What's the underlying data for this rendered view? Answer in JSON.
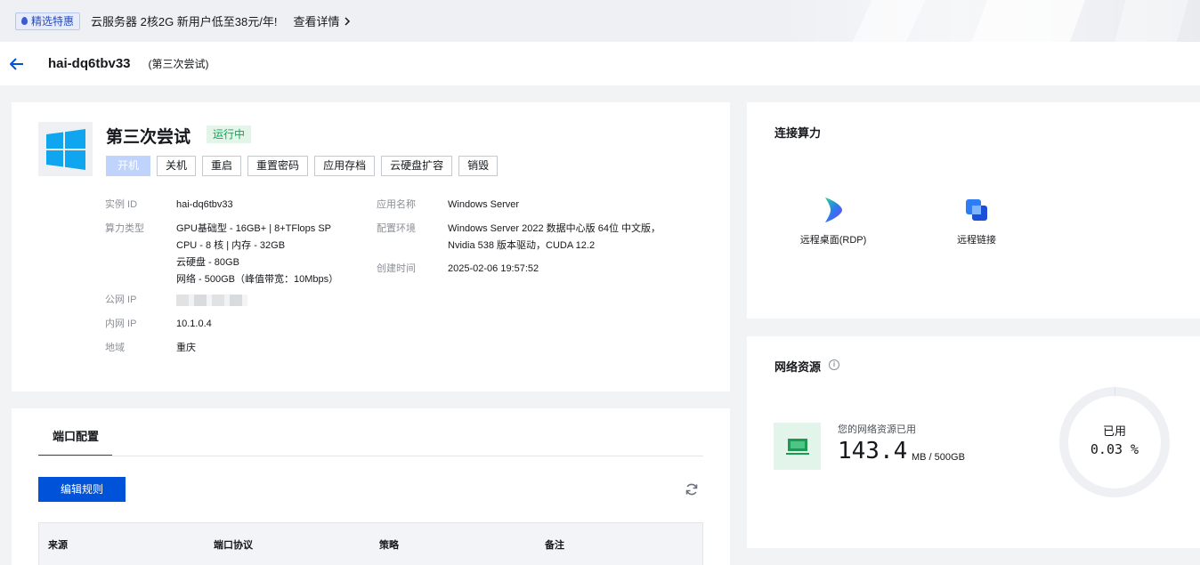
{
  "promo": {
    "badge": "精选特惠",
    "text": "云服务器 2核2G 新用户低至38元/年!",
    "link": "查看详情"
  },
  "header": {
    "title": "hai-dq6tbv33",
    "subtitle": "(第三次尝试)"
  },
  "instance": {
    "name": "第三次尝试",
    "status": "运行中",
    "buttons": [
      "开机",
      "关机",
      "重启",
      "重置密码",
      "应用存档",
      "云硬盘扩容",
      "销毁"
    ],
    "fields_left": [
      {
        "label": "实例 ID",
        "values": [
          "hai-dq6tbv33"
        ]
      },
      {
        "label": "算力类型",
        "values": [
          "GPU基础型 - 16GB+ | 8+TFlops SP",
          "CPU - 8 核 | 内存 - 32GB",
          "云硬盘 - 80GB",
          "网络 - 500GB（峰值带宽：10Mbps）"
        ]
      },
      {
        "label": "公网 IP",
        "values": []
      },
      {
        "label": "内网 IP",
        "values": [
          "10.1.0.4"
        ]
      },
      {
        "label": "地域",
        "values": [
          "重庆"
        ]
      }
    ],
    "fields_right": [
      {
        "label": "应用名称",
        "values": [
          "Windows Server"
        ]
      },
      {
        "label": "配置环境",
        "values": [
          "Windows Server 2022 数据中心版 64位 中文版，",
          "Nvidia 538 版本驱动，CUDA 12.2"
        ]
      },
      {
        "label": "创建时间",
        "values": [
          "2025-02-06 19:57:52"
        ]
      }
    ]
  },
  "connect": {
    "title": "连接算力",
    "items": [
      {
        "label": "远程桌面(RDP)",
        "icon": "rdp-icon"
      },
      {
        "label": "远程链接",
        "icon": "remote-link-icon"
      }
    ]
  },
  "network": {
    "title": "网络资源",
    "used_label": "您的网络资源已用",
    "used_value": "143.4",
    "used_unit": "MB / 500GB",
    "ring_label": "已用",
    "ring_value": "0.03 %",
    "ring_fraction": 0.0003
  },
  "port": {
    "tab": "端口配置",
    "edit_button": "编辑规则",
    "columns": [
      "来源",
      "端口协议",
      "策略",
      "备注"
    ]
  },
  "colors": {
    "primary": "#0052d9",
    "status_green": "#0aa65a",
    "disabled_blue": "#bfd3fc"
  }
}
